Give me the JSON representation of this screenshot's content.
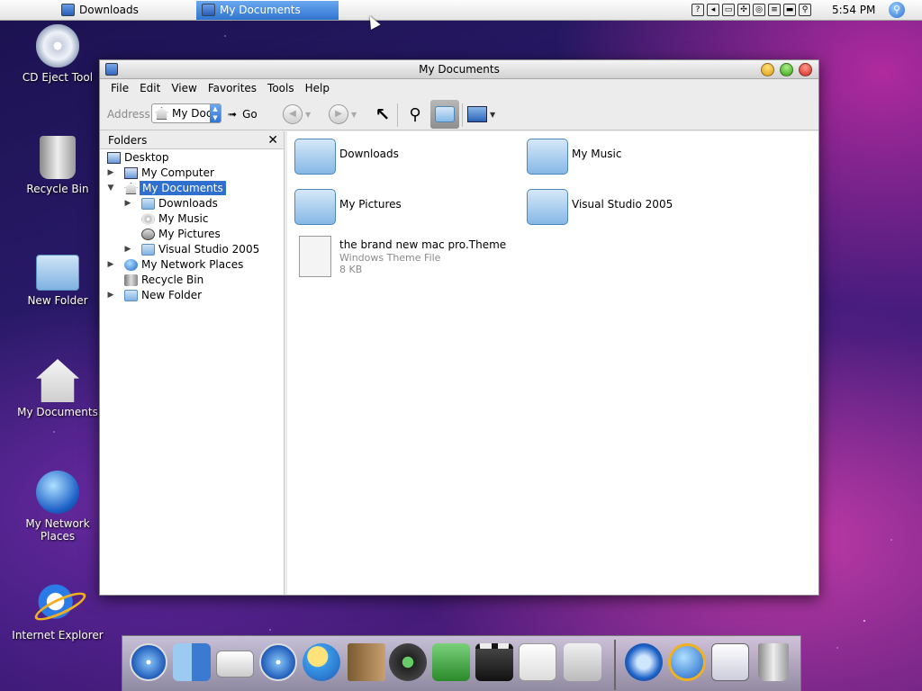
{
  "menubar": {
    "tasks": [
      {
        "label": "Downloads",
        "active": false
      },
      {
        "label": "My Documents",
        "active": true
      }
    ],
    "clock": "5:54 PM",
    "tray_icons": [
      "help-icon",
      "volume-icon",
      "battery-icon",
      "network-icon",
      "cd-icon",
      "keyboard-icon",
      "display-icon",
      "search-icon"
    ]
  },
  "desktop": {
    "icons": [
      {
        "label": "CD Eject Tool",
        "icon": "cd-icon"
      },
      {
        "label": "Recycle Bin",
        "icon": "trash-icon"
      },
      {
        "label": "New Folder",
        "icon": "folder-icon"
      },
      {
        "label": "My Documents",
        "icon": "home-icon"
      },
      {
        "label": "My Network Places",
        "icon": "globe-icon"
      },
      {
        "label": "Internet Explorer",
        "icon": "ie-icon"
      }
    ]
  },
  "window": {
    "title": "My Documents",
    "menu": [
      "File",
      "Edit",
      "View",
      "Favorites",
      "Tools",
      "Help"
    ],
    "toolbar": {
      "address_label": "Address",
      "address_value": "My Doc",
      "go_label": "Go"
    },
    "folders_pane": {
      "title": "Folders",
      "tree": [
        {
          "label": "Desktop",
          "level": 0,
          "expander": "none",
          "icon": "desktop-icon"
        },
        {
          "label": "My Computer",
          "level": 1,
          "expander": "collapsed",
          "icon": "computer-icon"
        },
        {
          "label": "My Documents",
          "level": 1,
          "expander": "expanded",
          "icon": "home-icon",
          "selected": true
        },
        {
          "label": "Downloads",
          "level": 2,
          "expander": "collapsed",
          "icon": "folder-icon"
        },
        {
          "label": "My Music",
          "level": 2,
          "expander": "none",
          "icon": "music-icon"
        },
        {
          "label": "My Pictures",
          "level": 2,
          "expander": "none",
          "icon": "pictures-icon"
        },
        {
          "label": "Visual Studio 2005",
          "level": 2,
          "expander": "collapsed",
          "icon": "folder-icon"
        },
        {
          "label": "My Network Places",
          "level": 1,
          "expander": "collapsed",
          "icon": "globe-icon"
        },
        {
          "label": "Recycle Bin",
          "level": 1,
          "expander": "none",
          "icon": "trash-icon"
        },
        {
          "label": "New Folder",
          "level": 1,
          "expander": "collapsed",
          "icon": "folder-icon"
        }
      ]
    },
    "content": {
      "items": [
        {
          "name": "Downloads",
          "icon": "folder-icon"
        },
        {
          "name": "My Music",
          "icon": "music-folder-icon"
        },
        {
          "name": "My Pictures",
          "icon": "pictures-folder-icon"
        },
        {
          "name": "Visual Studio 2005",
          "icon": "folder-icon"
        },
        {
          "name": "the brand new mac pro.Theme",
          "type": "Windows Theme File",
          "size": "8 KB",
          "icon": "theme-file-icon"
        }
      ]
    }
  },
  "dock": {
    "items": [
      "safari-icon",
      "finder-icon",
      "mail-icon",
      "safari-icon",
      "ichat-icon",
      "address-book-icon",
      "itunes-icon",
      "iphoto-icon",
      "imovie-icon",
      "ical-icon",
      "utilities-icon",
      "quicktime-icon",
      "network-icon",
      "windows-icon",
      "trash-icon"
    ]
  }
}
